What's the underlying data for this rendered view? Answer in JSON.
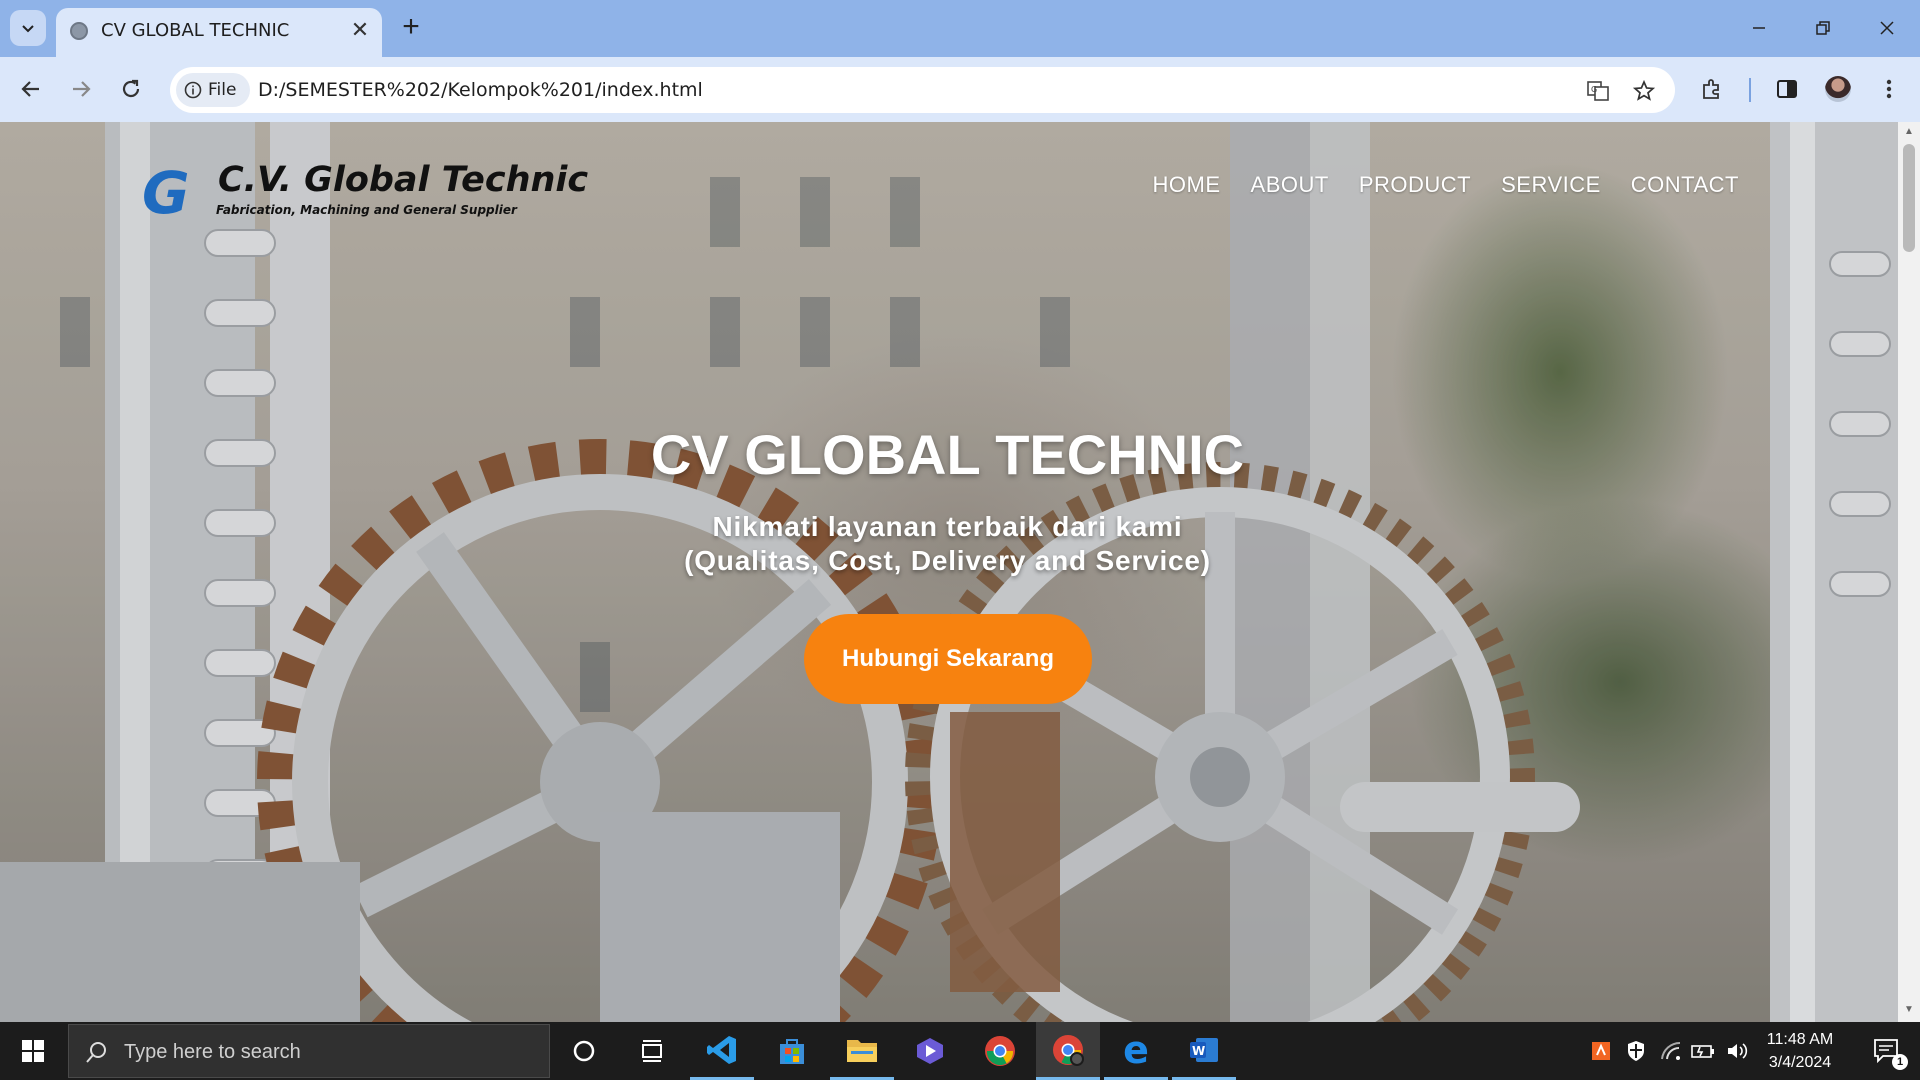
{
  "browser": {
    "tab_title": "CV GLOBAL TECHNIC",
    "new_tab_label": "+",
    "site_chip_label": "File",
    "url": "D:/SEMESTER%202/Kelompok%201/index.html"
  },
  "site": {
    "logo_letter": "G",
    "logo_title": "C.V. Global Technic",
    "logo_subtitle": "Fabrication, Machining and General Supplier",
    "nav": [
      "HOME",
      "ABOUT",
      "PRODUCT",
      "SERVICE",
      "CONTACT"
    ],
    "hero_title": "CV GLOBAL TECHNIC",
    "hero_line1": "Nikmati layanan terbaik dari kami",
    "hero_line2": "(Qualitas, Cost, Delivery and Service)",
    "cta_label": "Hubungi Sekarang"
  },
  "taskbar": {
    "search_placeholder": "Type here to search",
    "time": "11:48 AM",
    "date": "3/4/2024",
    "notification_count": "1"
  },
  "colors": {
    "accent": "#f7820f",
    "tab_strip": "#8fb3e8",
    "toolbar": "#dbe7fa",
    "logo_blue": "#1f6bbf"
  }
}
